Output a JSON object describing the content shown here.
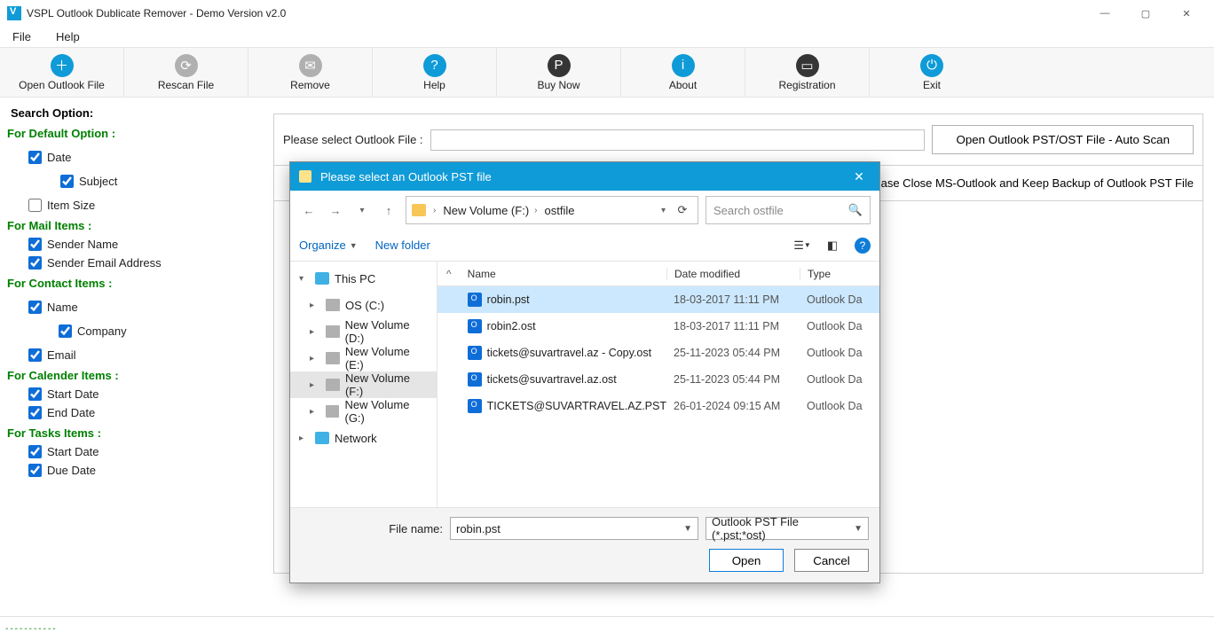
{
  "window": {
    "title": "VSPL Outlook Dublicate Remover - Demo Version v2.0"
  },
  "menu": {
    "file": "File",
    "help": "Help"
  },
  "toolbar": [
    {
      "label": "Open Outlook File",
      "glyph": "＋",
      "cls": "tb-blue"
    },
    {
      "label": "Rescan File",
      "glyph": "⟳",
      "cls": "tb-grey"
    },
    {
      "label": "Remove",
      "glyph": "✉",
      "cls": "tb-grey"
    },
    {
      "label": "Help",
      "glyph": "?",
      "cls": "tb-blue"
    },
    {
      "label": "Buy Now",
      "glyph": "P",
      "cls": "tb-dark"
    },
    {
      "label": "About",
      "glyph": "i",
      "cls": "tb-blue"
    },
    {
      "label": "Registration",
      "glyph": "▭",
      "cls": "tb-dark"
    },
    {
      "label": "Exit",
      "glyph": "⏻",
      "cls": "tb-blue"
    }
  ],
  "sidebar": {
    "legend": "Search Option:",
    "default": {
      "title": "For Default Option :",
      "date": "Date",
      "subject": "Subject",
      "itemsize": "Item Size",
      "date_c": true,
      "subject_c": true,
      "itemsize_c": false
    },
    "mail": {
      "title": "For Mail Items :",
      "sender": "Sender Name",
      "email": "Sender Email Address"
    },
    "contact": {
      "title": "For Contact Items :",
      "name": "Name",
      "company": "Company",
      "email": "Email"
    },
    "cal": {
      "title": "For Calender Items :",
      "start": "Start Date",
      "end": "End Date"
    },
    "task": {
      "title": "For Tasks Items :",
      "start": "Start Date",
      "due": "Due Date"
    }
  },
  "content": {
    "file_label": "Please select Outlook File :",
    "auto_scan": "Open Outlook PST/OST File - Auto Scan",
    "warning": "lease Close MS-Outlook and Keep Backup of Outlook PST File"
  },
  "dialog": {
    "title": "Please select an Outlook PST file",
    "breadcrumb": {
      "drive": "New Volume (F:)",
      "folder": "ostfile"
    },
    "search_ph": "Search ostfile",
    "organize": "Organize",
    "new_folder": "New folder",
    "cols": {
      "name": "Name",
      "date": "Date modified",
      "type": "Type"
    },
    "tree": [
      {
        "label": "This PC",
        "icon": "ic-pc",
        "depth": 0,
        "arrow": "▾"
      },
      {
        "label": "OS (C:)",
        "icon": "ic-drive",
        "depth": 1,
        "arrow": "▸"
      },
      {
        "label": "New Volume (D:)",
        "icon": "ic-drive",
        "depth": 1,
        "arrow": "▸"
      },
      {
        "label": "New Volume (E:)",
        "icon": "ic-drive",
        "depth": 1,
        "arrow": "▸"
      },
      {
        "label": "New Volume (F:)",
        "icon": "ic-drive",
        "depth": 1,
        "arrow": "▸",
        "selected": true
      },
      {
        "label": "New Volume (G:)",
        "icon": "ic-drive",
        "depth": 1,
        "arrow": "▸"
      },
      {
        "label": "Network",
        "icon": "ic-net",
        "depth": 0,
        "arrow": "▸"
      }
    ],
    "files": [
      {
        "name": "robin.pst",
        "date": "18-03-2017 11:11 PM",
        "type": "Outlook Da",
        "selected": true
      },
      {
        "name": "robin2.ost",
        "date": "18-03-2017 11:11 PM",
        "type": "Outlook Da"
      },
      {
        "name": "tickets@suvartravel.az - Copy.ost",
        "date": "25-11-2023 05:44 PM",
        "type": "Outlook Da"
      },
      {
        "name": "tickets@suvartravel.az.ost",
        "date": "25-11-2023 05:44 PM",
        "type": "Outlook Da"
      },
      {
        "name": "TICKETS@SUVARTRAVEL.AZ.PST",
        "date": "26-01-2024 09:15 AM",
        "type": "Outlook Da"
      }
    ],
    "filename_label": "File name:",
    "filename_value": "robin.pst",
    "filetype_value": "Outlook PST File (*.pst;*ost)",
    "open": "Open",
    "cancel": "Cancel"
  },
  "status": {
    "dashes": "-----------"
  }
}
